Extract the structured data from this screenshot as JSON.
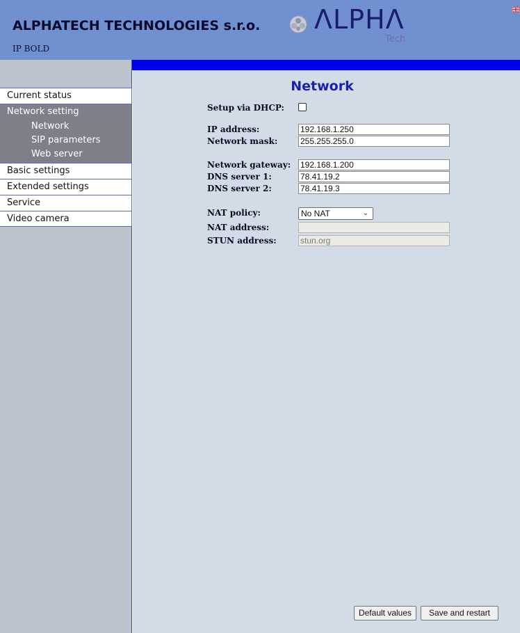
{
  "header": {
    "company": "ALPHATECH TECHNOLOGIES s.r.o.",
    "product": "IP BOLD",
    "logo_word": "ΛLPHΛ",
    "logo_sub": "Tech",
    "colors": {
      "header_bg": "#7090d0",
      "accent_bar": "#0000ee",
      "title": "#1c20b0"
    }
  },
  "sidebar": {
    "items": [
      {
        "label": "Current status"
      },
      {
        "label": "Network setting",
        "children": [
          {
            "label": "Network"
          },
          {
            "label": "SIP parameters"
          },
          {
            "label": "Web server"
          }
        ]
      },
      {
        "label": "Basic settings"
      },
      {
        "label": "Extended settings"
      },
      {
        "label": "Service"
      },
      {
        "label": "Video camera"
      }
    ]
  },
  "main": {
    "title": "Network",
    "dhcp": {
      "label": "Setup via DHCP:",
      "checked": false
    },
    "ip_address": {
      "label": "IP address:",
      "value": "192.168.1.250"
    },
    "network_mask": {
      "label": "Network mask:",
      "value": "255.255.255.0"
    },
    "gateway": {
      "label": "Network gateway:",
      "value": "192.168.1.200"
    },
    "dns1": {
      "label": "DNS server 1:",
      "value": "78.41.19.2"
    },
    "dns2": {
      "label": "DNS server 2:",
      "value": "78.41.19.3"
    },
    "nat_policy": {
      "label": "NAT policy:",
      "value": "No NAT"
    },
    "nat_address": {
      "label": "NAT address:",
      "value": ""
    },
    "stun_address": {
      "label": "STUN address:",
      "value": "stun.org"
    }
  },
  "buttons": {
    "default_values": "Default values",
    "save_restart": "Save and restart"
  }
}
